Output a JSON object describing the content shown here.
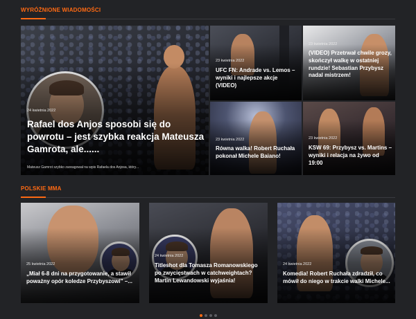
{
  "sections": {
    "featured": {
      "title": "WYRÓŻNIONE WIADOMOŚCI"
    },
    "polish": {
      "title": "POLSKIE MMA"
    }
  },
  "featured": {
    "main": {
      "date": "24 kwietnia 2022",
      "title": "Rafael dos Anjos sposobi się do powrotu – jest szybka reakcja Mateusza Gamrota, ale......",
      "excerpt": "Mateusz Gamrot szybko zareagował na wpis Rafaela dos Anjosa, który..."
    },
    "small": [
      {
        "date": "23 kwietnia 2022",
        "title": "UFC FN: Andrade vs. Lemos – wyniki i najlepsze akcje (VIDEO)"
      },
      {
        "date": "23 kwietnia 2022",
        "title": "(VIDEO) Przetrwał chwile grozy, skończył walkę w ostatniej rundzie! Sebastian Przybysz nadal mistrzem!"
      },
      {
        "date": "23 kwietnia 2022",
        "title": "Równa walka! Robert Ruchała pokonał Michele Baiano!"
      },
      {
        "date": "23 kwietnia 2022",
        "title": "KSW 69: Przybysz vs. Martins – wyniki i relacja na żywo od 19:00"
      }
    ]
  },
  "polish": [
    {
      "date": "25 kwietnia 2022",
      "title": "„Miał 6-8 dni na przygotowanie, a stawił poważny opór koledze Przybyszowi” –..."
    },
    {
      "date": "24 kwietnia 2022",
      "title": "Titleshot dla Tomasza Romanowskiego po zwycięstwach w catchweightach? Martin Lewandowski wyjaśnia!"
    },
    {
      "date": "24 kwietnia 2022",
      "title": "Komedia! Robert Ruchała zdradził, co mówił do niego w trakcie walki Michele..."
    }
  ],
  "pagination": {
    "pages": 4,
    "current": 1
  },
  "colors": {
    "accent": "#ff6a13",
    "background": "#222326"
  },
  "icons": {
    "pagination": "dot-indicator"
  }
}
